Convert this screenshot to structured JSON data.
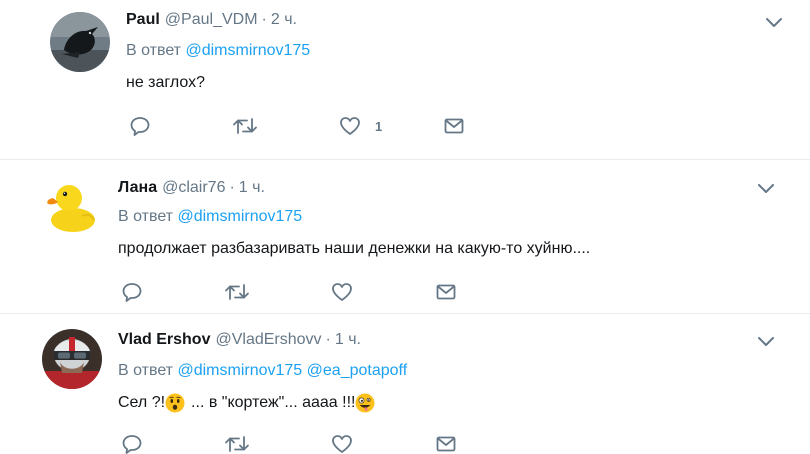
{
  "tweets": [
    {
      "name": "Paul",
      "handle": "@Paul_VDM",
      "separator": "·",
      "time": "2 ч.",
      "reply_prefix": "В ответ",
      "mentions": [
        "@dimsmirnov175"
      ],
      "text": "не заглох?",
      "like_count": "1",
      "avatar_icon": "raven-avatar"
    },
    {
      "name": "Лана",
      "handle": "@clair76",
      "separator": "·",
      "time": "1 ч.",
      "reply_prefix": "В ответ",
      "mentions": [
        "@dimsmirnov175"
      ],
      "text": "продолжает разбазаривать наши денежки на какую-то хуйню....",
      "like_count": "",
      "avatar_icon": "rubber-duck-avatar"
    },
    {
      "name": "Vlad Ershov",
      "handle": "@VladErshovv",
      "separator": "·",
      "time": "1 ч.",
      "reply_prefix": "В ответ",
      "mentions": [
        "@dimsmirnov175",
        "@ea_potapoff"
      ],
      "text_parts": [
        "Сел ?!",
        "... в \"кортеж\"... аааа !!!"
      ],
      "emojis": [
        "hushed-face-emoji",
        "zany-face-emoji"
      ],
      "like_count": "",
      "avatar_icon": "helmet-avatar"
    }
  ],
  "icons": {
    "reply": "reply-icon",
    "retweet": "retweet-icon",
    "like": "heart-icon",
    "dm": "envelope-icon",
    "more": "chevron-down-icon"
  },
  "colors": {
    "text": "#14171a",
    "secondary": "#657786",
    "link": "#1da1f2",
    "divider": "#e6ecf0"
  }
}
